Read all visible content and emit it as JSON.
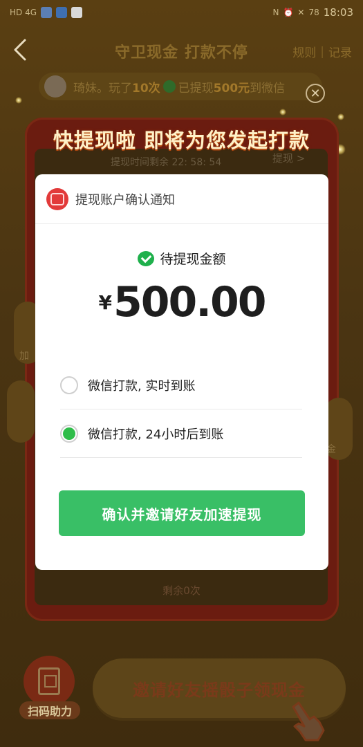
{
  "status_bar": {
    "left_text": "HD 4G",
    "right_text": "78",
    "time": "18:03"
  },
  "nav": {
    "title": "守卫现金 打款不停",
    "rules": "规则",
    "separator": "|",
    "records": "记录"
  },
  "ticker": {
    "prefix": "琦妹。玩了",
    "count": "10次",
    "mid": "已提现",
    "amount": "500元",
    "suffix": "到微信"
  },
  "backdrop": {
    "countdown": "提现时间剩余 22: 58: 54",
    "withdraw_link": "提现 >",
    "remaining": "剩余0次",
    "side_left_label": "加",
    "side_right_label": "金"
  },
  "headline": "快提现啦 即将为您发起打款",
  "modal": {
    "title": "提现账户确认通知",
    "amount_label": "待提现金额",
    "currency": "¥",
    "amount": "500.00",
    "options": [
      {
        "label": "微信打款, 实时到账",
        "checked": false
      },
      {
        "label": "微信打款, 24小时后到账",
        "checked": true
      }
    ],
    "confirm_label": "确认并邀请好友加速提现"
  },
  "bottom": {
    "qr_label": "扫码助力",
    "invite_label": "邀请好友摇骰子领现金"
  },
  "colors": {
    "confirm": "#39bf66",
    "radio_checked": "#2fbd4a",
    "wechat": "#1fb04c"
  }
}
